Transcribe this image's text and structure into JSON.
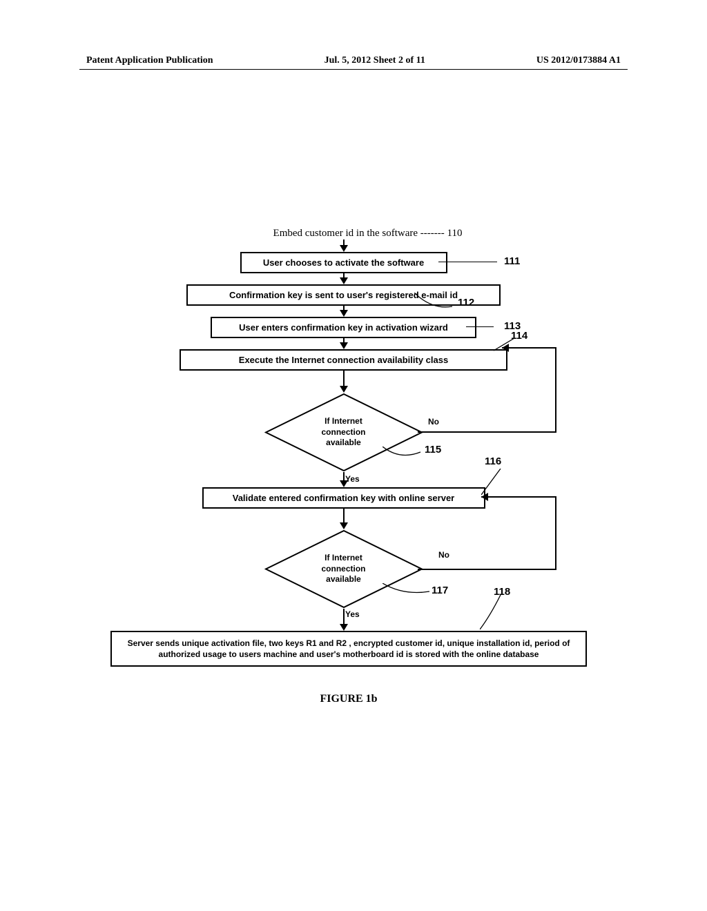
{
  "header": {
    "left": "Patent Application Publication",
    "center": "Jul. 5, 2012  Sheet 2 of 11",
    "right": "US 2012/0173884 A1"
  },
  "embed_line": "Embed customer id in the software ------- 110",
  "steps": {
    "s111": "User chooses to activate the software",
    "s112": "Confirmation key is sent to user's registered  e-mail id",
    "s113": "User enters confirmation key in activation wizard",
    "s114": "Execute the  Internet connection   availability   class",
    "d115": "If Internet\nconnection\navailable",
    "s116": "Validate entered confirmation key with online server",
    "d117": "If Internet\nconnection\navailable",
    "s118": "Server sends unique activation file, two keys     R1 and R2 , encrypted customer id, unique installation id, period of authorized usage to users machine and user's motherboard id is stored with the online database"
  },
  "labels": {
    "n110": "110",
    "n111": "111",
    "n112": "112",
    "n113": "113",
    "n114": "114",
    "n115": "115",
    "n116": "116",
    "n117": "117",
    "n118": "118",
    "yes": "Yes",
    "no": "No"
  },
  "figure_caption": "FIGURE 1b"
}
